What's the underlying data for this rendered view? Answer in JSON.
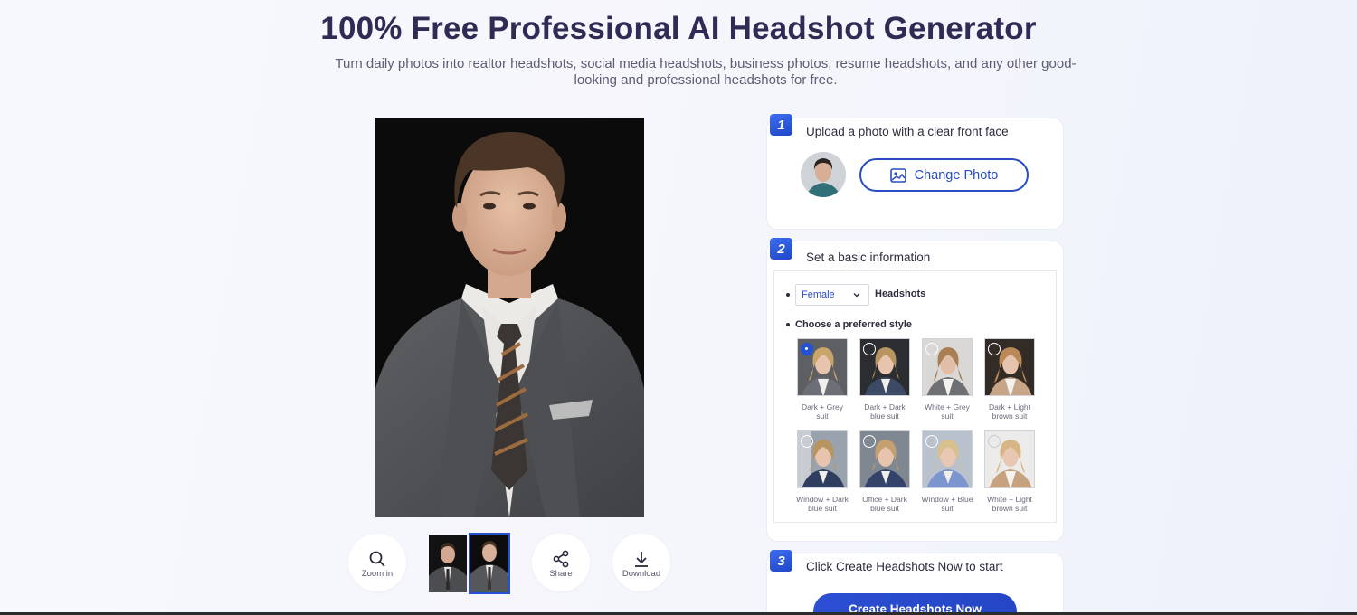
{
  "hero": {
    "title": "100% Free Professional AI Headshot Generator",
    "subtitle": "Turn daily photos into realtor headshots, social media headshots, business photos, resume headshots, and any other good-looking and professional headshots for free."
  },
  "preview": {
    "image_subject": "young man in dark grey suit with striped tie"
  },
  "toolbar": {
    "zoom_label": "Zoom in",
    "share_label": "Share",
    "download_label": "Download",
    "zoom_icon": "search-icon",
    "share_icon": "share-icon",
    "download_icon": "download-icon",
    "selected_thumbnail": 2
  },
  "steps": {
    "step1": {
      "number": "1",
      "title": "Upload a photo with a clear front face",
      "change_photo_label": "Change Photo"
    },
    "step2": {
      "number": "2",
      "title": "Set a basic information",
      "gender_selected": "Female",
      "headshots_label": "Headshots",
      "style_prompt": "Choose a preferred style",
      "styles": [
        {
          "label": "Dark + Grey suit",
          "selected": true
        },
        {
          "label": "Dark + Dark blue suit",
          "selected": false
        },
        {
          "label": "White + Grey suit",
          "selected": false
        },
        {
          "label": "Dark + Light brown suit",
          "selected": false
        },
        {
          "label": "Window + Dark blue suit",
          "selected": false
        },
        {
          "label": "Office + Dark blue suit",
          "selected": false
        },
        {
          "label": "Window + Blue suit",
          "selected": false
        },
        {
          "label": "White + Light brown suit",
          "selected": false
        }
      ]
    },
    "step3": {
      "number": "3",
      "title": "Click Create Headshots Now to start",
      "create_label": "Create Headshots Now"
    }
  },
  "colors": {
    "accent": "#2451d6",
    "title": "#2e2c54",
    "preview_bg": "#0b0b0c"
  }
}
